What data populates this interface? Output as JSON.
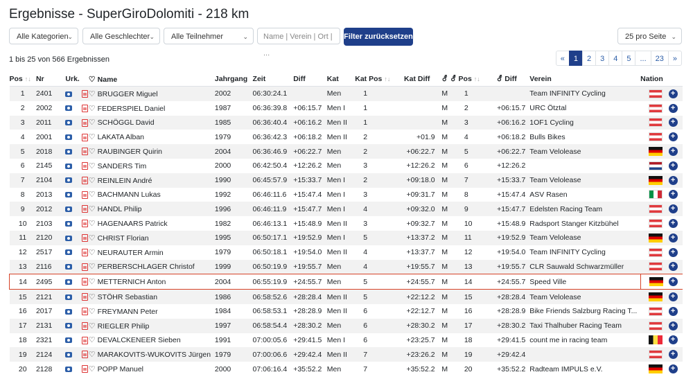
{
  "page": {
    "title": "Ergebnisse - SuperGiroDolomiti - 218 km"
  },
  "filters": {
    "category": "Alle Kategorien",
    "gender": "Alle Geschlechter",
    "participants": "Alle Teilnehmer",
    "search_placeholder": "Name | Verein | Ort | ...",
    "reset_label": "Filter zurücksetzen",
    "per_page": "25 pro Seite"
  },
  "results_count": "1 bis 25 von 566 Ergebnissen",
  "pagination": [
    "«",
    "1",
    "2",
    "3",
    "4",
    "5",
    "...",
    "23",
    "»"
  ],
  "pagination_active": "1",
  "columns": {
    "pos": "Pos",
    "nr": "Nr",
    "urk": "Urk.",
    "name": "Name",
    "jahrgang": "Jahrgang",
    "zeit": "Zeit",
    "diff": "Diff",
    "kat": "Kat",
    "kat_pos": "Kat Pos",
    "kat_diff": "Kat Diff",
    "sex": "⚦",
    "sex_pos": "⚦ Pos",
    "sex_diff": "⚦ Diff",
    "verein": "Verein",
    "nation": "Nation"
  },
  "icons": {
    "sort": "sort-icon",
    "heart": "heart-icon",
    "camera": "camera-icon",
    "pdf": "pdf-icon",
    "expand": "plus-circle-icon"
  },
  "highlight_row": 14,
  "rows": [
    {
      "pos": "1",
      "nr": "2401",
      "name": "BRUGGER Miguel",
      "jahrgang": "2002",
      "zeit": "06:30:24.1",
      "diff": "",
      "kat": "Men",
      "kat_pos": "1",
      "kat_diff": "",
      "sex": "M",
      "sex_pos": "1",
      "sex_diff": "",
      "verein": "Team INFINITY Cycling",
      "nation": "at"
    },
    {
      "pos": "2",
      "nr": "2002",
      "name": "FEDERSPIEL Daniel",
      "jahrgang": "1987",
      "zeit": "06:36:39.8",
      "diff": "+06:15.7",
      "kat": "Men I",
      "kat_pos": "1",
      "kat_diff": "",
      "sex": "M",
      "sex_pos": "2",
      "sex_diff": "+06:15.7",
      "verein": "URC Ötztal",
      "nation": "at"
    },
    {
      "pos": "3",
      "nr": "2011",
      "name": "SCHÖGGL David",
      "jahrgang": "1985",
      "zeit": "06:36:40.4",
      "diff": "+06:16.2",
      "kat": "Men II",
      "kat_pos": "1",
      "kat_diff": "",
      "sex": "M",
      "sex_pos": "3",
      "sex_diff": "+06:16.2",
      "verein": "1OF1 Cycling",
      "nation": "at"
    },
    {
      "pos": "4",
      "nr": "2001",
      "name": "LAKATA Alban",
      "jahrgang": "1979",
      "zeit": "06:36:42.3",
      "diff": "+06:18.2",
      "kat": "Men II",
      "kat_pos": "2",
      "kat_diff": "+01.9",
      "sex": "M",
      "sex_pos": "4",
      "sex_diff": "+06:18.2",
      "verein": "Bulls Bikes",
      "nation": "at"
    },
    {
      "pos": "5",
      "nr": "2018",
      "name": "RAUBINGER Quirin",
      "jahrgang": "2004",
      "zeit": "06:36:46.9",
      "diff": "+06:22.7",
      "kat": "Men",
      "kat_pos": "2",
      "kat_diff": "+06:22.7",
      "sex": "M",
      "sex_pos": "5",
      "sex_diff": "+06:22.7",
      "verein": "Team Velolease",
      "nation": "de"
    },
    {
      "pos": "6",
      "nr": "2145",
      "name": "SANDERS Tim",
      "jahrgang": "2000",
      "zeit": "06:42:50.4",
      "diff": "+12:26.2",
      "kat": "Men",
      "kat_pos": "3",
      "kat_diff": "+12:26.2",
      "sex": "M",
      "sex_pos": "6",
      "sex_diff": "+12:26.2",
      "verein": "",
      "nation": "nl"
    },
    {
      "pos": "7",
      "nr": "2104",
      "name": "REINLEIN André",
      "jahrgang": "1990",
      "zeit": "06:45:57.9",
      "diff": "+15:33.7",
      "kat": "Men I",
      "kat_pos": "2",
      "kat_diff": "+09:18.0",
      "sex": "M",
      "sex_pos": "7",
      "sex_diff": "+15:33.7",
      "verein": "Team Velolease",
      "nation": "de"
    },
    {
      "pos": "8",
      "nr": "2013",
      "name": "BACHMANN Lukas",
      "jahrgang": "1992",
      "zeit": "06:46:11.6",
      "diff": "+15:47.4",
      "kat": "Men I",
      "kat_pos": "3",
      "kat_diff": "+09:31.7",
      "sex": "M",
      "sex_pos": "8",
      "sex_diff": "+15:47.4",
      "verein": "ASV Rasen",
      "nation": "it"
    },
    {
      "pos": "9",
      "nr": "2012",
      "name": "HANDL Philip",
      "jahrgang": "1996",
      "zeit": "06:46:11.9",
      "diff": "+15:47.7",
      "kat": "Men I",
      "kat_pos": "4",
      "kat_diff": "+09:32.0",
      "sex": "M",
      "sex_pos": "9",
      "sex_diff": "+15:47.7",
      "verein": "Edelsten Racing Team",
      "nation": "at"
    },
    {
      "pos": "10",
      "nr": "2103",
      "name": "HAGENAARS Patrick",
      "jahrgang": "1982",
      "zeit": "06:46:13.1",
      "diff": "+15:48.9",
      "kat": "Men II",
      "kat_pos": "3",
      "kat_diff": "+09:32.7",
      "sex": "M",
      "sex_pos": "10",
      "sex_diff": "+15:48.9",
      "verein": "Radsport Stanger Kitzbühel",
      "nation": "at"
    },
    {
      "pos": "11",
      "nr": "2120",
      "name": "CHRIST Florian",
      "jahrgang": "1995",
      "zeit": "06:50:17.1",
      "diff": "+19:52.9",
      "kat": "Men I",
      "kat_pos": "5",
      "kat_diff": "+13:37.2",
      "sex": "M",
      "sex_pos": "11",
      "sex_diff": "+19:52.9",
      "verein": "Team Velolease",
      "nation": "de"
    },
    {
      "pos": "12",
      "nr": "2517",
      "name": "NEURAUTER Armin",
      "jahrgang": "1979",
      "zeit": "06:50:18.1",
      "diff": "+19:54.0",
      "kat": "Men II",
      "kat_pos": "4",
      "kat_diff": "+13:37.7",
      "sex": "M",
      "sex_pos": "12",
      "sex_diff": "+19:54.0",
      "verein": "Team INFINITY Cycling",
      "nation": "at"
    },
    {
      "pos": "13",
      "nr": "2116",
      "name": "PERBERSCHLAGER Christof",
      "jahrgang": "1999",
      "zeit": "06:50:19.9",
      "diff": "+19:55.7",
      "kat": "Men",
      "kat_pos": "4",
      "kat_diff": "+19:55.7",
      "sex": "M",
      "sex_pos": "13",
      "sex_diff": "+19:55.7",
      "verein": "CLR Sauwald Schwarzmüller",
      "nation": "at"
    },
    {
      "pos": "14",
      "nr": "2495",
      "name": "METTERNICH Anton",
      "jahrgang": "2004",
      "zeit": "06:55:19.9",
      "diff": "+24:55.7",
      "kat": "Men",
      "kat_pos": "5",
      "kat_diff": "+24:55.7",
      "sex": "M",
      "sex_pos": "14",
      "sex_diff": "+24:55.7",
      "verein": "Speed Ville",
      "nation": "de"
    },
    {
      "pos": "15",
      "nr": "2121",
      "name": "STÖHR Sebastian",
      "jahrgang": "1986",
      "zeit": "06:58:52.6",
      "diff": "+28:28.4",
      "kat": "Men II",
      "kat_pos": "5",
      "kat_diff": "+22:12.2",
      "sex": "M",
      "sex_pos": "15",
      "sex_diff": "+28:28.4",
      "verein": "Team Velolease",
      "nation": "de"
    },
    {
      "pos": "16",
      "nr": "2017",
      "name": "FREYMANN Peter",
      "jahrgang": "1984",
      "zeit": "06:58:53.1",
      "diff": "+28:28.9",
      "kat": "Men II",
      "kat_pos": "6",
      "kat_diff": "+22:12.7",
      "sex": "M",
      "sex_pos": "16",
      "sex_diff": "+28:28.9",
      "verein": "Bike Friends Salzburg Racing T...",
      "nation": "at"
    },
    {
      "pos": "17",
      "nr": "2131",
      "name": "RIEGLER Philip",
      "jahrgang": "1997",
      "zeit": "06:58:54.4",
      "diff": "+28:30.2",
      "kat": "Men",
      "kat_pos": "6",
      "kat_diff": "+28:30.2",
      "sex": "M",
      "sex_pos": "17",
      "sex_diff": "+28:30.2",
      "verein": "Taxi Thalhuber Racing Team",
      "nation": "at"
    },
    {
      "pos": "18",
      "nr": "2321",
      "name": "DEVALCKENEER Sieben",
      "jahrgang": "1991",
      "zeit": "07:00:05.6",
      "diff": "+29:41.5",
      "kat": "Men I",
      "kat_pos": "6",
      "kat_diff": "+23:25.7",
      "sex": "M",
      "sex_pos": "18",
      "sex_diff": "+29:41.5",
      "verein": "count me in racing team",
      "nation": "be"
    },
    {
      "pos": "19",
      "nr": "2124",
      "name": "MARAKOVITS-WUKOVITS Jürgen",
      "jahrgang": "1979",
      "zeit": "07:00:06.6",
      "diff": "+29:42.4",
      "kat": "Men II",
      "kat_pos": "7",
      "kat_diff": "+23:26.2",
      "sex": "M",
      "sex_pos": "19",
      "sex_diff": "+29:42.4",
      "verein": "",
      "nation": "at"
    },
    {
      "pos": "20",
      "nr": "2128",
      "name": "POPP Manuel",
      "jahrgang": "2000",
      "zeit": "07:06:16.4",
      "diff": "+35:52.2",
      "kat": "Men",
      "kat_pos": "7",
      "kat_diff": "+35:52.2",
      "sex": "M",
      "sex_pos": "20",
      "sex_diff": "+35:52.2",
      "verein": "Radteam IMPULS e.V.",
      "nation": "de"
    }
  ]
}
